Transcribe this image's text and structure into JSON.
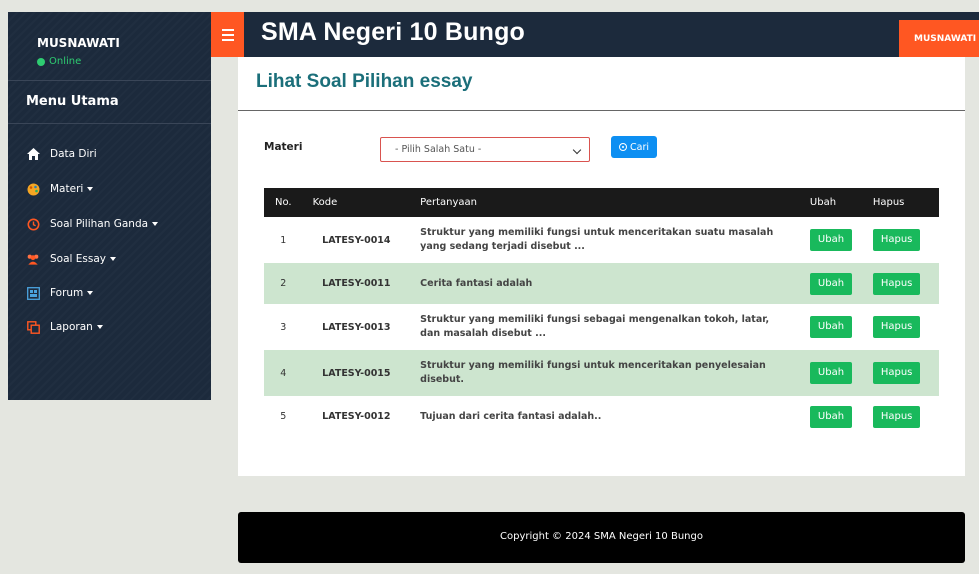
{
  "sidebar": {
    "user_name": "MUSNAWATI",
    "status": "Online",
    "menu_title": "Menu Utama",
    "items": [
      {
        "label": "Data Diri",
        "icon": "home-icon",
        "dropdown": false
      },
      {
        "label": "Materi",
        "icon": "palette-icon",
        "dropdown": true
      },
      {
        "label": "Soal Pilihan Ganda",
        "icon": "clock-icon",
        "dropdown": true
      },
      {
        "label": "Soal Essay",
        "icon": "users-icon",
        "dropdown": true
      },
      {
        "label": "Forum",
        "icon": "forum-icon",
        "dropdown": true
      },
      {
        "label": "Laporan",
        "icon": "copy-icon",
        "dropdown": true
      }
    ]
  },
  "topbar": {
    "title": "SMA Negeri 10 Bungo",
    "user_menu": "MUSNAWATI"
  },
  "main": {
    "page_title": "Lihat Soal Pilihan essay",
    "filter": {
      "label": "Materi",
      "select_value": "- Pilih Salah Satu -",
      "search_label": "Cari"
    },
    "table": {
      "headers": [
        "No.",
        "Kode",
        "Pertanyaan",
        "Ubah",
        "Hapus"
      ],
      "rows": [
        {
          "no": "1",
          "kode": "LATESY-0014",
          "pertanyaan": "Struktur yang memiliki fungsi untuk menceritakan suatu masalah yang sedang terjadi disebut ...",
          "ubah": "Ubah",
          "hapus": "Hapus"
        },
        {
          "no": "2",
          "kode": "LATESY-0011",
          "pertanyaan": "Cerita fantasi adalah",
          "ubah": "Ubah",
          "hapus": "Hapus"
        },
        {
          "no": "3",
          "kode": "LATESY-0013",
          "pertanyaan": "Struktur yang memiliki fungsi sebagai mengenalkan tokoh, latar, dan masalah disebut ...",
          "ubah": "Ubah",
          "hapus": "Hapus"
        },
        {
          "no": "4",
          "kode": "LATESY-0015",
          "pertanyaan": "Struktur yang memiliki fungsi untuk menceritakan penyelesaian disebut.",
          "ubah": "Ubah",
          "hapus": "Hapus"
        },
        {
          "no": "5",
          "kode": "LATESY-0012",
          "pertanyaan": "Tujuan dari cerita fantasi adalah..",
          "ubah": "Ubah",
          "hapus": "Hapus"
        }
      ]
    }
  },
  "footer": {
    "text": "Copyright © 2024 SMA Negeri 10 Bungo"
  },
  "colors": {
    "sidebar_bg": "#1c2a3c",
    "accent_orange": "#ff5722",
    "title_teal": "#1b6f7a",
    "button_green": "#19b95c",
    "button_blue": "#0d8ff2",
    "row_highlight": "#cde5cf"
  }
}
